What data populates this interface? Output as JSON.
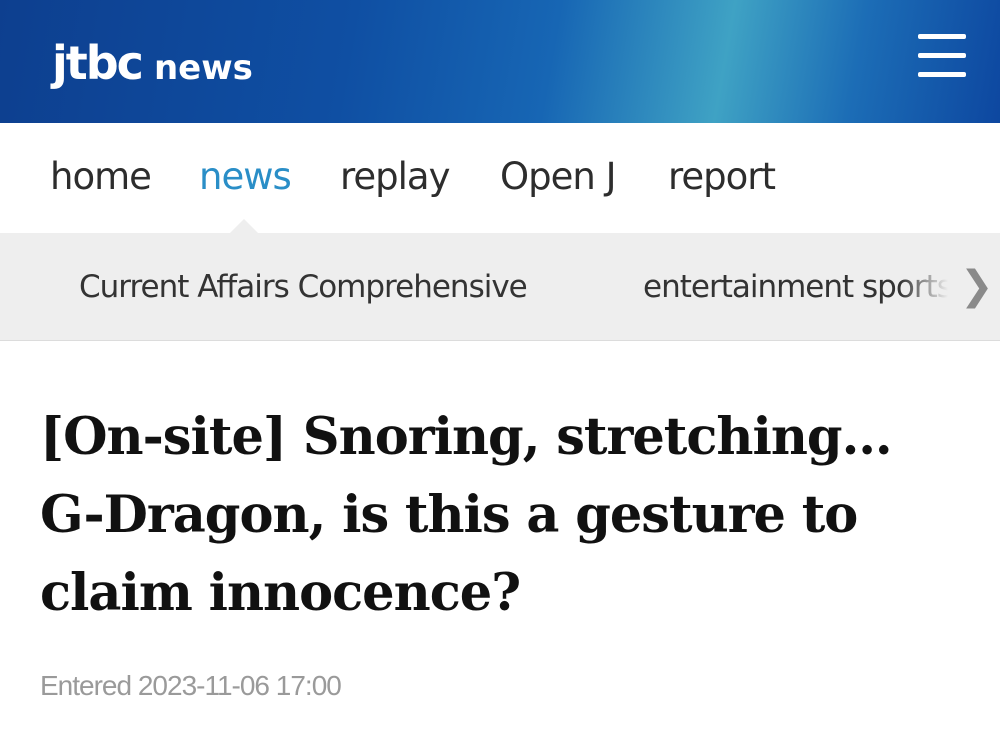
{
  "header": {
    "logo_mark": "jtbc",
    "logo_word": "news",
    "menu_icon": "hamburger-menu-icon",
    "gradient_colors": [
      "#0d3f8f",
      "#3fa2c4",
      "#0d47a0"
    ]
  },
  "main_nav": {
    "items": [
      {
        "label": "home"
      },
      {
        "label": "news",
        "active": true
      },
      {
        "label": "replay"
      },
      {
        "label": "Open J"
      },
      {
        "label": "report"
      }
    ],
    "active_color": "#2a8ec7"
  },
  "sub_nav": {
    "items": [
      {
        "label": "Current Affairs Comprehensive"
      },
      {
        "label": "entertainment sports"
      }
    ],
    "next_icon": "chevron-right-icon"
  },
  "article": {
    "headline": "[On-site] Snoring, stretching… G-Dragon, is this a gesture to claim innocence?",
    "entered_label": "Entered",
    "entered_datetime": "2023-11-06 17:00"
  }
}
